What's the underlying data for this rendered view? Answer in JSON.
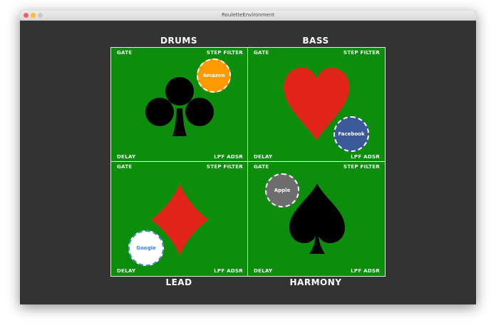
{
  "window": {
    "title": "RouletteEnvironment",
    "buttons": {
      "close_color": "#ff5f57",
      "minimize_color": "#febc2e",
      "zoom_color": "#c8c8c8"
    }
  },
  "sections": {
    "top_left": {
      "title": "DRUMS",
      "suit": "club-icon",
      "suit_color": "#000000",
      "labels": {
        "top_left": "GATE",
        "top_right": "STEP FILTER",
        "bottom_left": "DELAY",
        "bottom_right": "LPF ADSR"
      },
      "chip": {
        "label": "Amazon",
        "color": "#ff9900",
        "text_color": "#ffffff"
      }
    },
    "top_right": {
      "title": "BASS",
      "suit": "heart-icon",
      "suit_color": "#e1251b",
      "labels": {
        "top_left": "GATE",
        "top_right": "STEP FILTER",
        "bottom_left": "DELAY",
        "bottom_right": "LPF ADSR"
      },
      "chip": {
        "label": "Facebook",
        "color": "#3b5998",
        "text_color": "#ffffff"
      }
    },
    "bottom_left": {
      "title": "LEAD",
      "suit": "diamond-icon",
      "suit_color": "#e1251b",
      "labels": {
        "top_left": "GATE",
        "top_right": "STEP FILTER",
        "bottom_left": "DELAY",
        "bottom_right": "LPF ADSR"
      },
      "chip": {
        "label": "Google",
        "color": "#ffffff",
        "text_color": "#4285f4"
      }
    },
    "bottom_right": {
      "title": "HARMONY",
      "suit": "spade-icon",
      "suit_color": "#000000",
      "labels": {
        "top_left": "GATE",
        "top_right": "STEP FILTER",
        "bottom_left": "DELAY",
        "bottom_right": "LPF ADSR"
      },
      "chip": {
        "label": "Apple",
        "color": "#6d6d6d",
        "text_color": "#ffffff"
      }
    }
  },
  "colors": {
    "felt": "#0c8e0c",
    "background": "#333333",
    "divider": "#e8e8e8"
  }
}
